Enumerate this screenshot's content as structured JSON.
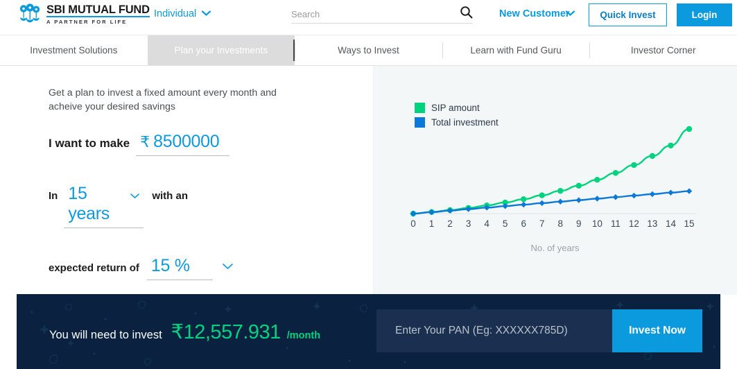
{
  "brand": {
    "title": "SBI MUTUAL FUND",
    "tagline": "A PARTNER FOR LIFE",
    "logo_icon": "sbi-keyhole-tree-icon",
    "accent_blue": "#0c9ade",
    "dark_navy": "#0a2240",
    "green": "#00d37f"
  },
  "header": {
    "audience_selector": "Individual",
    "audience_chevron_icon": "chevron-down-icon",
    "search": {
      "value": "",
      "placeholder": "Search",
      "icon": "search-icon"
    },
    "new_customer": "New Customer",
    "new_customer_chevron_icon": "chevron-down-icon",
    "quick_invest": "Quick Invest",
    "login": "Login"
  },
  "nav": {
    "items": [
      {
        "label": "Investment Solutions",
        "active": false
      },
      {
        "label": "Plan your Investments",
        "active": true
      },
      {
        "label": "Ways to Invest",
        "active": false
      },
      {
        "label": "Learn with Fund Guru",
        "active": false
      },
      {
        "label": "Investor Corner",
        "active": false
      }
    ]
  },
  "calculator": {
    "intro": "Get a plan to invest a fixed amount every month and acheive your desired savings",
    "goal": {
      "label": "I want to make",
      "currency": "₹",
      "amount": "8500000"
    },
    "duration": {
      "prefix": "In",
      "value": "15 years",
      "chevron_icon": "chevron-down-icon",
      "suffix": "with an"
    },
    "rate": {
      "label": "expected return of",
      "value": "15 %",
      "chevron_icon": "chevron-down-icon"
    }
  },
  "chart_data": {
    "type": "line",
    "title": "",
    "xlabel": "No. of years",
    "ylabel": "",
    "grid": false,
    "legend_position": "top-left",
    "x": [
      0,
      1,
      2,
      3,
      4,
      5,
      6,
      7,
      8,
      9,
      10,
      11,
      12,
      13,
      14,
      15
    ],
    "xlim": [
      0,
      15
    ],
    "ylim": [
      0,
      8500000
    ],
    "xticks": [
      "0",
      "1",
      "2",
      "3",
      "4",
      "5",
      "6",
      "7",
      "8",
      "9",
      "10",
      "11",
      "12",
      "13",
      "14",
      "15"
    ],
    "series": [
      {
        "name": "SIP amount",
        "color": "#00d37f",
        "marker": "circle",
        "values": [
          0,
          163000,
          352000,
          571000,
          824000,
          1116000,
          1452000,
          1841000,
          2289000,
          2806000,
          3402000,
          4089000,
          4881000,
          5793000,
          6844000,
          8500000
        ]
      },
      {
        "name": "Total investment",
        "color": "#0c78d8",
        "marker": "diamond",
        "values": [
          0,
          150695,
          301390,
          452085,
          602780,
          753475,
          904170,
          1054865,
          1205560,
          1356255,
          1506950,
          1657645,
          1808340,
          1959035,
          2109730,
          2260427
        ]
      }
    ]
  },
  "cta": {
    "label": "You will need to invest",
    "amount": "₹12,557.931",
    "per": "/month",
    "pan": {
      "value": "",
      "placeholder": "Enter Your PAN (Eg: XXXXXX785D)"
    },
    "invest_button": "Invest Now"
  }
}
